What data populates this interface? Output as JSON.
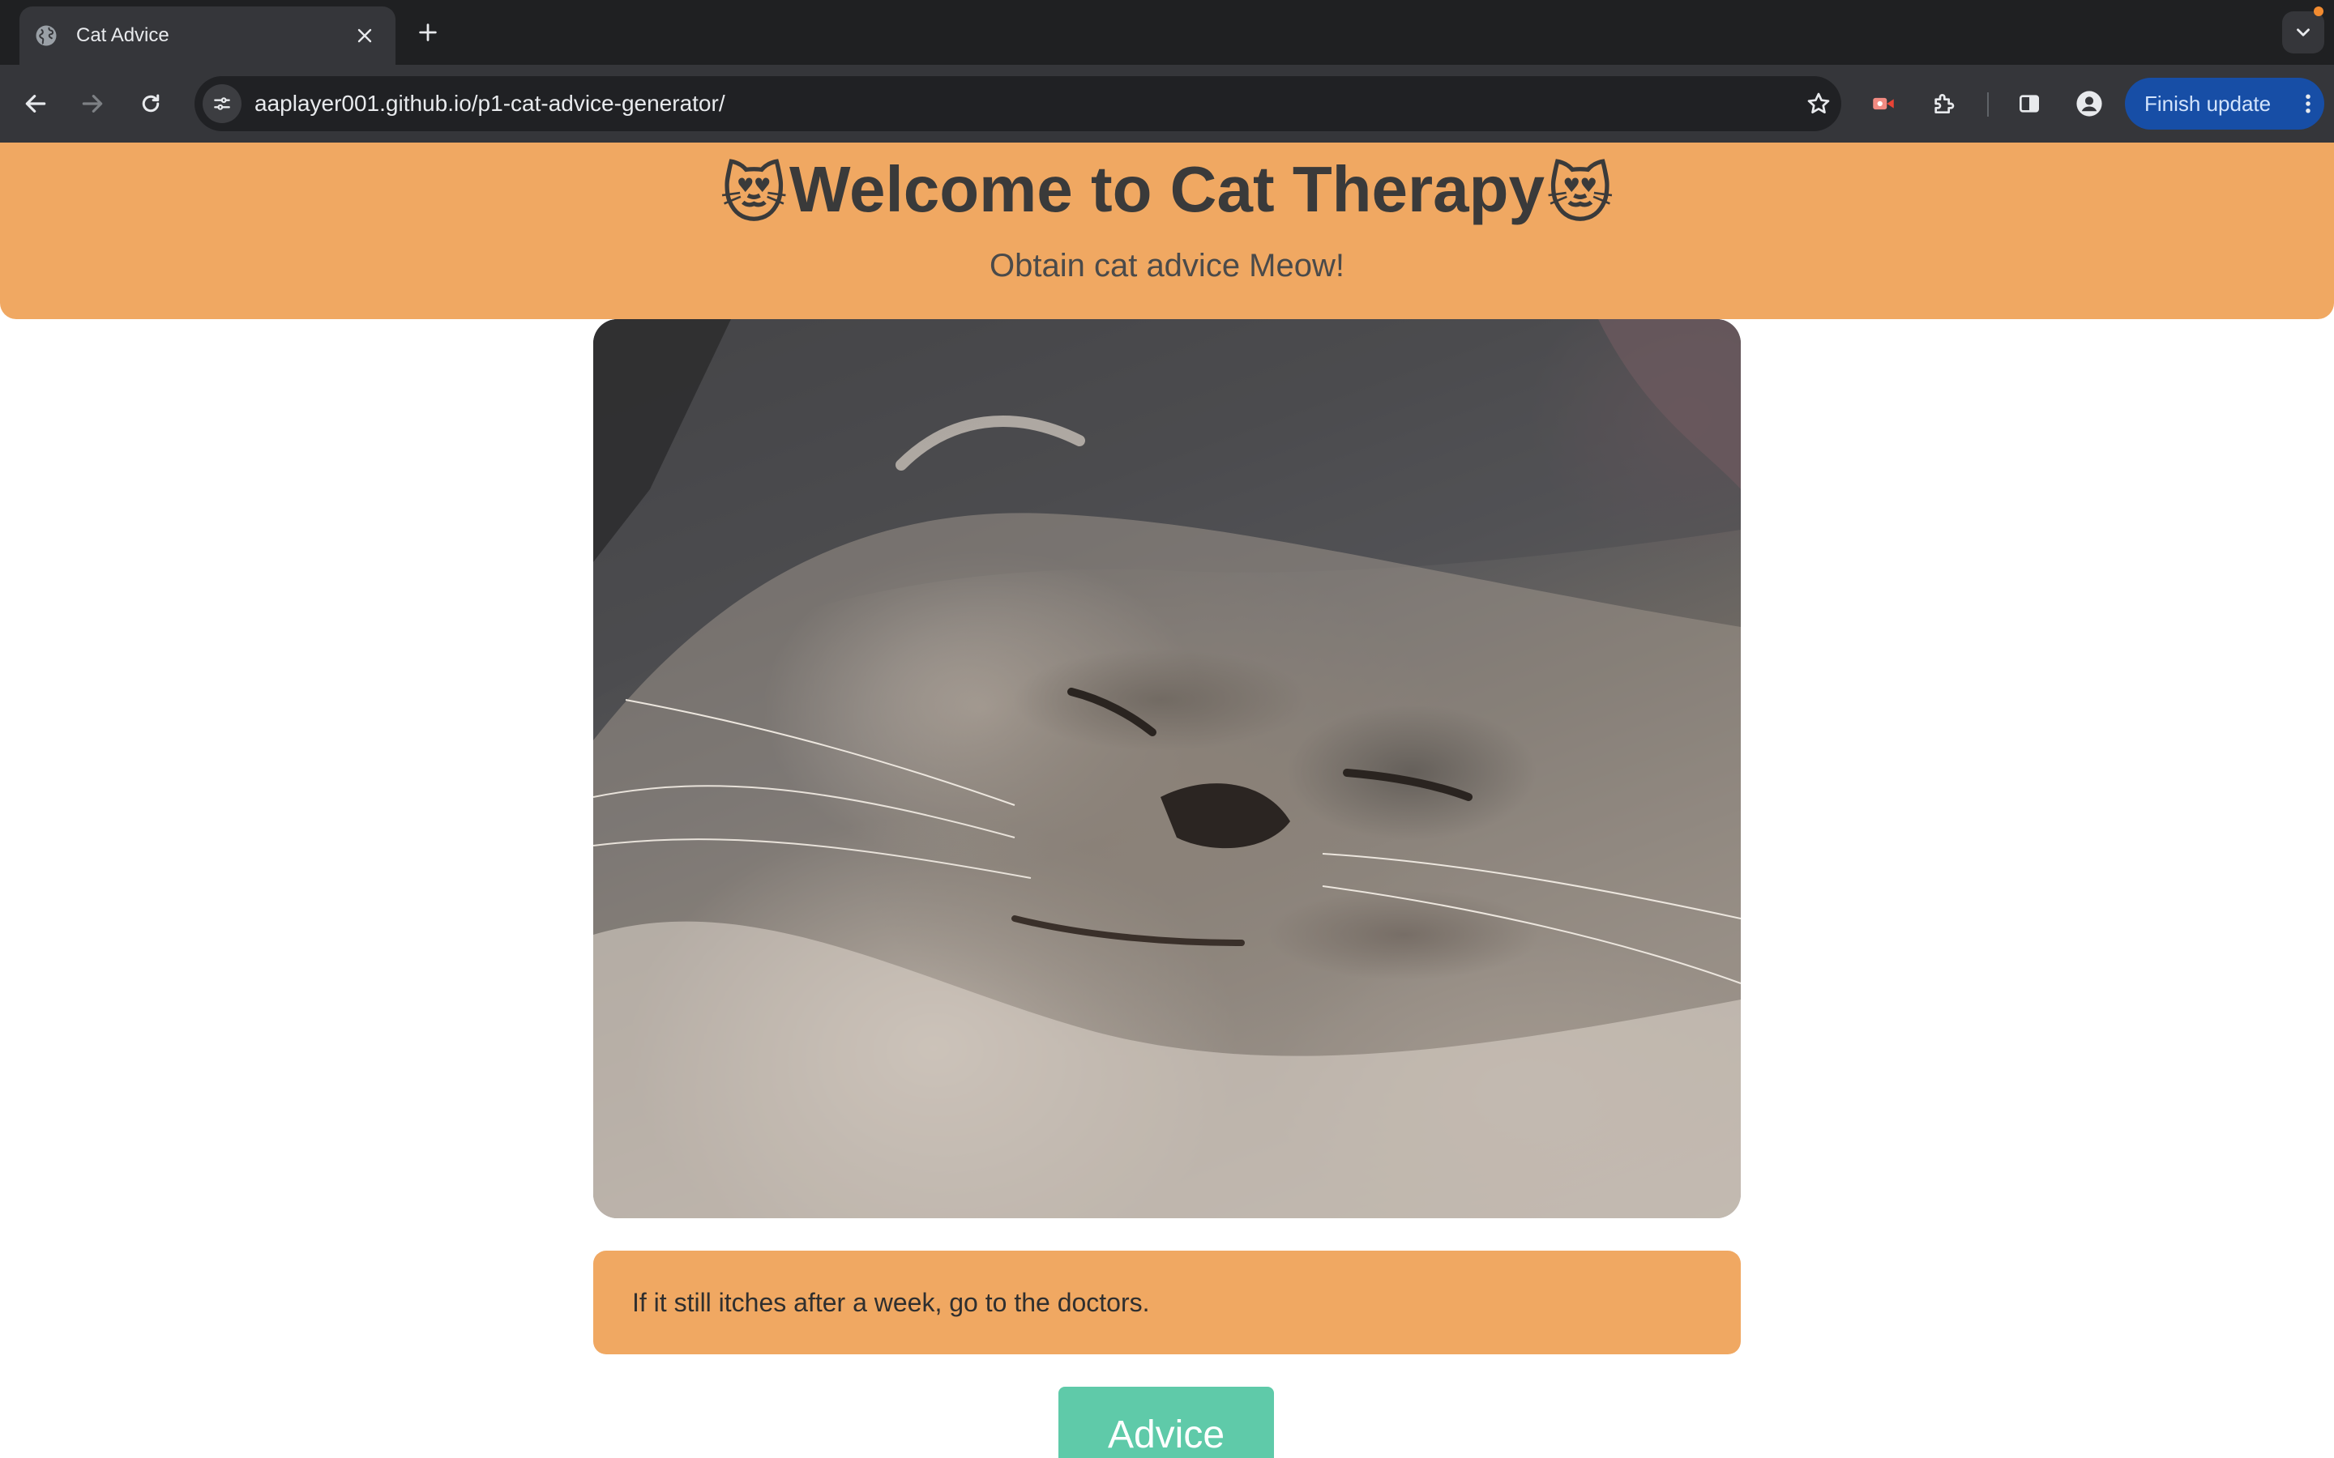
{
  "browser": {
    "tab": {
      "title": "Cat Advice",
      "favicon": "globe-icon"
    },
    "url": {
      "host": "aaplayer001.github.io",
      "path": "/p1-cat-advice-generator/"
    },
    "finish_update_label": "Finish update",
    "accent_color": "#174ea6"
  },
  "page": {
    "header": {
      "title": "Welcome to Cat Therapy",
      "emoji": "😻",
      "subtitle": "Obtain cat advice Meow!"
    },
    "advice_text": "If it still itches after a week, go to the doctors.",
    "advice_button_label": "Advice",
    "colors": {
      "header": "#f0a862",
      "advice_box": "#f0a862",
      "button": "#5fcaa9"
    }
  }
}
